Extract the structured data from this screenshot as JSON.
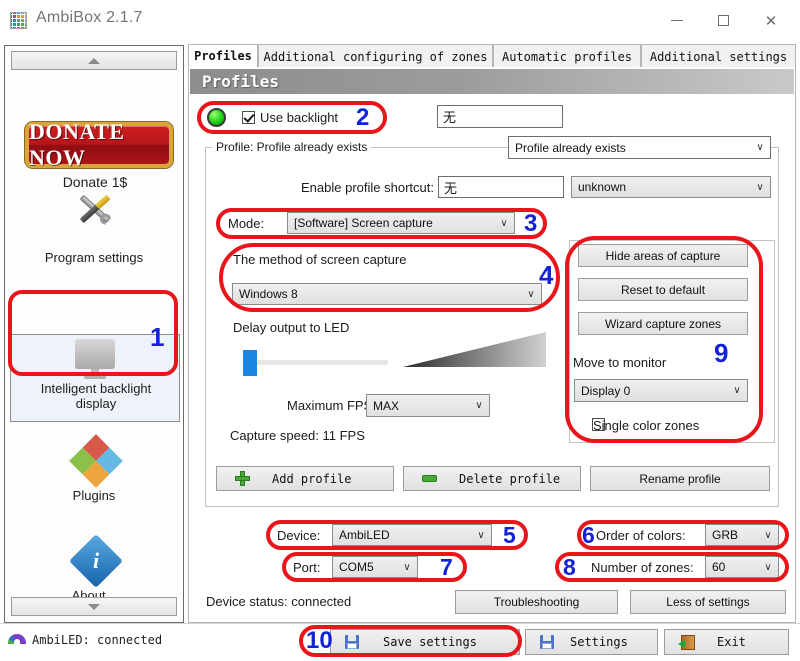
{
  "window": {
    "title": "AmbiBox 2.1.7",
    "minimize": "–",
    "maximize": "□",
    "close": "✕"
  },
  "sidebar": {
    "scroll_up": "▲",
    "scroll_down": "▼",
    "donate_button": "DONATE NOW",
    "donate_caption": "Donate 1$",
    "items": [
      {
        "label": "Program settings",
        "icon": "tools-icon"
      },
      {
        "label": "Intelligent backlight display",
        "label_line1": "Intelligent backlight",
        "label_line2": "display",
        "icon": "monitor-icon",
        "selected": true,
        "badge": "1"
      },
      {
        "label": "Plugins",
        "icon": "puzzle-icon"
      },
      {
        "label": "About...",
        "icon": "info-icon"
      }
    ]
  },
  "tabs": [
    {
      "label": "Profiles",
      "active": true
    },
    {
      "label": "Additional configuring of zones",
      "active": false
    },
    {
      "label": "Automatic profiles",
      "active": false
    },
    {
      "label": "Additional settings",
      "active": false
    }
  ],
  "section": {
    "title": "Profiles"
  },
  "backlight": {
    "led_status": "on",
    "checkbox_label": "Use backlight",
    "checkbox_checked": true,
    "badge": "2",
    "profile_name_value": "无"
  },
  "profile_group": {
    "title": "Profile: Profile already exists",
    "profile_combo_value": "Profile already exists",
    "shortcut_label": "Enable profile shortcut:",
    "shortcut_value": "无",
    "shortcut_state_combo": "unknown",
    "mode_label": "Mode:",
    "mode_value": "[Software] Screen capture",
    "mode_badge": "3"
  },
  "capture": {
    "method_label": "The method of screen capture",
    "method_value": "Windows 8",
    "method_badge": "4",
    "delay_label": "Delay output to LED",
    "max_fps_label": "Maximum FPS",
    "max_fps_value": "MAX",
    "capture_speed": "Capture speed: 11 FPS"
  },
  "zones_panel": {
    "hide_areas_button": "Hide areas of capture",
    "reset_button": "Reset to default",
    "wizard_button": "Wizard capture zones",
    "move_to_monitor_label": "Move to monitor",
    "monitor_value": "Display 0",
    "single_color_label": "Single color zones",
    "single_color_checked": false,
    "badge": "9"
  },
  "profile_buttons": {
    "add": "Add profile",
    "delete": "Delete profile",
    "rename": "Rename profile"
  },
  "device": {
    "device_label": "Device:",
    "device_value": "AmbiLED",
    "device_badge": "5",
    "port_label": "Port:",
    "port_value": "COM5",
    "port_badge": "7",
    "order_label": "Order of colors:",
    "order_value": "GRB",
    "order_badge": "6",
    "zones_label": "Number of zones:",
    "zones_value": "60",
    "zones_badge": "8",
    "status": "Device status: connected",
    "troubleshooting": "Troubleshooting",
    "less_settings": "Less of settings"
  },
  "footer": {
    "save_badge": "10",
    "save": "Save settings",
    "settings": "Settings",
    "exit": "Exit"
  },
  "statusbar": {
    "text": "AmbiLED: connected"
  },
  "colors": {
    "annotation_red": "#e8161a",
    "badge_blue": "#1322d8",
    "led_green": "#19d219",
    "accent_blue": "#1a86e0"
  }
}
